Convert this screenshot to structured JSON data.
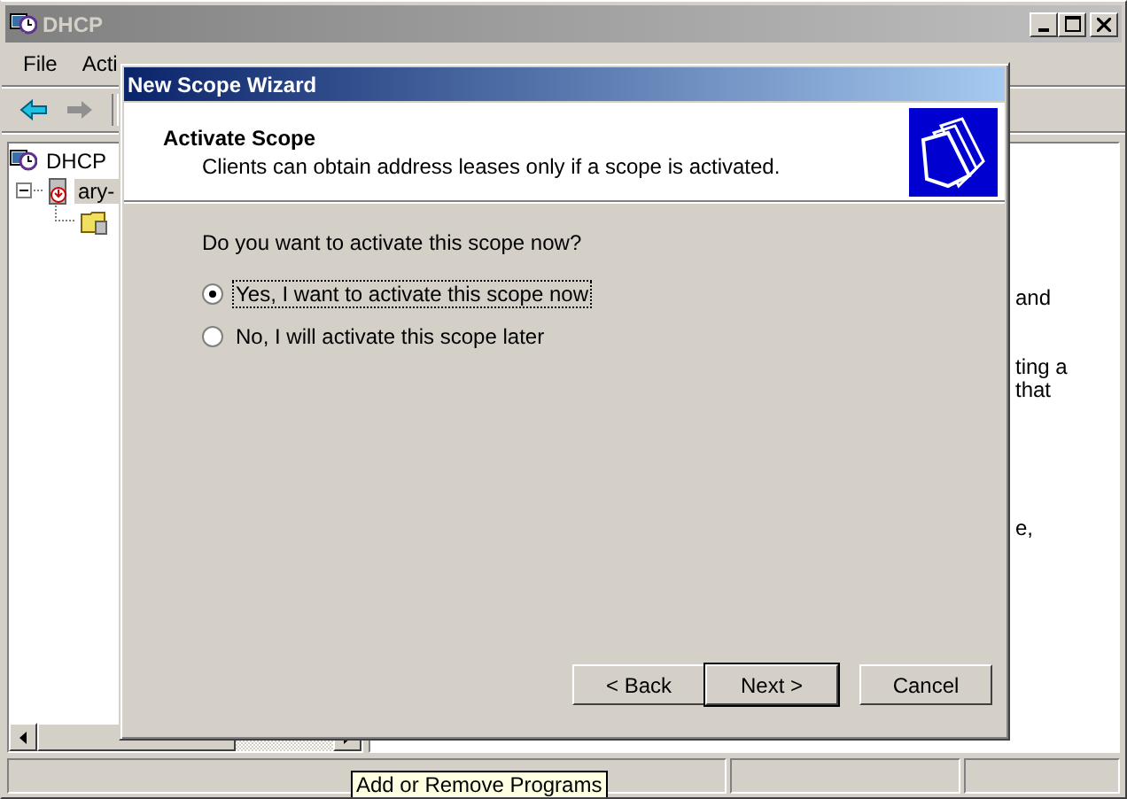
{
  "window": {
    "title": "DHCP",
    "menu": [
      "File",
      "Acti"
    ]
  },
  "tree": [
    {
      "label": "DHCP",
      "selected": false,
      "children": [
        {
          "label": "ary-",
          "selected": true,
          "expanded": true
        }
      ]
    }
  ],
  "details_lines": [
    [
      "and"
    ],
    [
      "ting a",
      "that"
    ],
    [
      "e,"
    ]
  ],
  "dialog": {
    "title": "New Scope Wizard",
    "heading": "Activate Scope",
    "subtitle": "Clients can obtain address leases only if a scope is activated.",
    "question": "Do you want to activate this scope now?",
    "options": [
      {
        "label": "Yes, I want to activate this scope now",
        "selected": true
      },
      {
        "label": "No, I will activate this scope later",
        "selected": false
      }
    ],
    "buttons": [
      {
        "label": "< Back",
        "kind": "normal"
      },
      {
        "label": "Next >",
        "kind": "default"
      },
      {
        "label": "Cancel",
        "kind": "cancel"
      }
    ]
  },
  "tooltip": "Add or Remove Programs"
}
